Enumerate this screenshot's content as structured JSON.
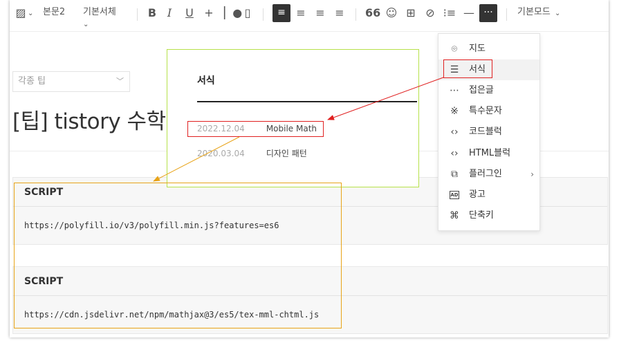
{
  "toolbar": {
    "image_chevron": "⌄",
    "paragraph_style": "본문2",
    "font": "기본서체",
    "mode": "기본모드"
  },
  "category_select": {
    "value": "각종 팁"
  },
  "post_title": "[팁] tistory 수학 지",
  "format_panel": {
    "title": "서식",
    "rows": [
      {
        "date": "2022.12.04",
        "name": "Mobile Math"
      },
      {
        "date": "2020.03.04",
        "name": "디자인 패턴"
      }
    ]
  },
  "more_menu": {
    "items": [
      {
        "label": "지도",
        "icon": "map-pin-icon"
      },
      {
        "label": "서식",
        "icon": "template-icon"
      },
      {
        "label": "접은글",
        "icon": "fold-icon"
      },
      {
        "label": "특수문자",
        "icon": "special-char-icon"
      },
      {
        "label": "코드블럭",
        "icon": "code-icon"
      },
      {
        "label": "HTML블럭",
        "icon": "html-icon"
      },
      {
        "label": "플러그인",
        "icon": "plugin-icon"
      },
      {
        "label": "광고",
        "icon": "ad-icon"
      },
      {
        "label": "단축키",
        "icon": "shortcut-icon"
      }
    ]
  },
  "script_blocks": [
    {
      "label": "SCRIPT",
      "content": "https://polyfill.io/v3/polyfill.min.js?features=es6"
    },
    {
      "label": "SCRIPT",
      "content": "https://cdn.jsdelivr.net/npm/mathjax@3/es5/tex-mml-chtml.js"
    }
  ],
  "colors": {
    "annotation_red": "#e02020",
    "annotation_orange": "#e8a317",
    "panel_border": "#b6e14a"
  }
}
